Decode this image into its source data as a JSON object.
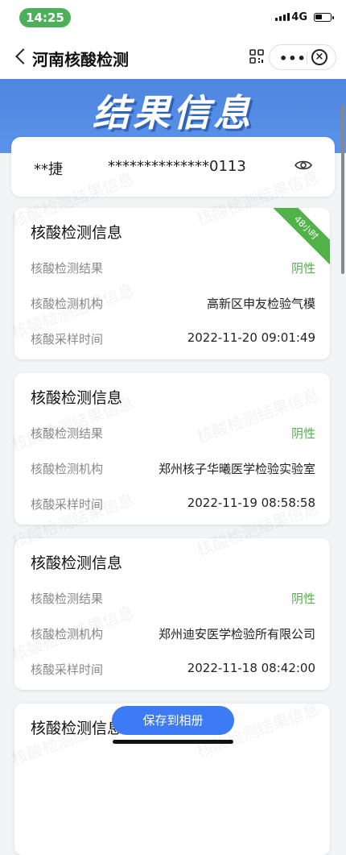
{
  "status_bar": {
    "time": "14:25",
    "network": "4G"
  },
  "navbar": {
    "title": "河南核酸检测"
  },
  "banner": {
    "title": "结果信息"
  },
  "identity": {
    "name": "**捷",
    "id_number": "**************0113"
  },
  "watermark": "核酸检测结果信息",
  "badge_text": "48小时",
  "records": [
    {
      "title": "核酸检测信息",
      "result_label": "核酸检测结果",
      "result_value": "阴性",
      "org_label": "核酸检测机构",
      "org_value": "高新区申友检验气模",
      "time_label": "核酸采样时间",
      "time_value": "2022-11-20 09:01:49"
    },
    {
      "title": "核酸检测信息",
      "result_label": "核酸检测结果",
      "result_value": "阴性",
      "org_label": "核酸检测机构",
      "org_value": "郑州核子华曦医学检验实验室",
      "time_label": "核酸采样时间",
      "time_value": "2022-11-19 08:58:58"
    },
    {
      "title": "核酸检测信息",
      "result_label": "核酸检测结果",
      "result_value": "阴性",
      "org_label": "核酸检测机构",
      "org_value": "郑州迪安医学检验所有限公司",
      "time_label": "核酸采样时间",
      "time_value": "2022-11-18 08:42:00"
    },
    {
      "title": "核酸检测信息"
    }
  ],
  "save_button": "保存到相册",
  "colors": {
    "accent": "#3d7bf5",
    "negative_green": "#52b24a",
    "banner_blue": "#4e86e0"
  }
}
